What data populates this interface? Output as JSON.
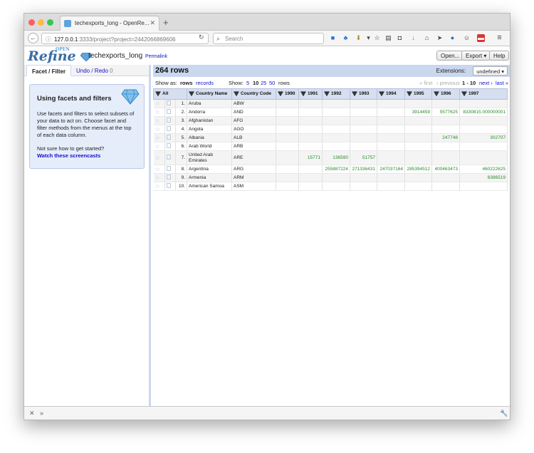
{
  "browser": {
    "tab_title": "techexports_long - OpenRe...",
    "tab_close": "✕",
    "new_tab": "+",
    "url_host": "127.0.0.1",
    "url_path": ":3333/project?project=2442066869606",
    "search_placeholder": "Search",
    "toolbar_icons": [
      "reading-list-icon",
      "share-icon",
      "download-icon",
      "bookmark-icon",
      "clipboard-icon",
      "pocket-icon",
      "downloads-icon",
      "home-icon",
      "send-icon",
      "drop-icon",
      "emoji-icon",
      "extension-icon",
      "menu-icon"
    ]
  },
  "header": {
    "logo": "Refine",
    "logo_open": "OPEN",
    "project_name": "techexports_long",
    "permalink": "Permalink",
    "buttons": {
      "open": "Open...",
      "export": "Export ▾",
      "help": "Help"
    }
  },
  "left": {
    "tabs": {
      "facet": "Facet / Filter",
      "undo": "Undo / Redo",
      "undo_count": "0"
    },
    "help": {
      "title": "Using facets and filters",
      "body": "Use facets and filters to select subsets of your data to act on. Choose facet and filter methods from the menus at the top of each data column.",
      "question": "Not sure how to get started?",
      "link": "Watch these screencasts"
    }
  },
  "main": {
    "row_count": "264 rows",
    "extensions_label": "Extensions:",
    "extensions_value": "undefined ▾",
    "show_as_label": "Show as:",
    "show_rows": "rows",
    "show_records": "records",
    "show_label": "Show:",
    "page_sizes": [
      "5",
      "10",
      "25",
      "50"
    ],
    "rows_word": "rows",
    "pager": {
      "first": "« first",
      "previous": "‹ previous",
      "range": "1 - 10",
      "next": "next ›",
      "last": "last »"
    }
  },
  "grid": {
    "columns": [
      "All",
      "Country Name",
      "Country Code",
      "1990",
      "1991",
      "1992",
      "1993",
      "1994",
      "1995",
      "1996",
      "1997"
    ],
    "rows": [
      {
        "idx": "1.",
        "name": "Aruba",
        "code": "ABW",
        "v": [
          "",
          "",
          "",
          "",
          "",
          "",
          "",
          ""
        ]
      },
      {
        "idx": "2.",
        "name": "Andorra",
        "code": "AND",
        "v": [
          "",
          "",
          "",
          "",
          "",
          "3914459",
          "5577625",
          "8330815.000000001"
        ]
      },
      {
        "idx": "3.",
        "name": "Afghanistan",
        "code": "AFG",
        "v": [
          "",
          "",
          "",
          "",
          "",
          "",
          "",
          ""
        ]
      },
      {
        "idx": "4.",
        "name": "Angola",
        "code": "AGO",
        "v": [
          "",
          "",
          "",
          "",
          "",
          "",
          "",
          ""
        ]
      },
      {
        "idx": "5.",
        "name": "Albania",
        "code": "ALB",
        "v": [
          "",
          "",
          "",
          "",
          "",
          "",
          "247748",
          "302707"
        ]
      },
      {
        "idx": "6.",
        "name": "Arab World",
        "code": "ARB",
        "v": [
          "",
          "",
          "",
          "",
          "",
          "",
          "",
          ""
        ]
      },
      {
        "idx": "7.",
        "name": "United Arab Emirates",
        "code": "ARE",
        "v": [
          "",
          "15771",
          "136590",
          "51757",
          "",
          "",
          "",
          ""
        ]
      },
      {
        "idx": "8.",
        "name": "Argentina",
        "code": "ARG",
        "v": [
          "",
          "",
          "255887224",
          "271336431",
          "247037164",
          "285394512",
          "400463473",
          "460222625"
        ]
      },
      {
        "idx": "9.",
        "name": "Armenia",
        "code": "ARM",
        "v": [
          "",
          "",
          "",
          "",
          "",
          "",
          "",
          "6386519"
        ]
      },
      {
        "idx": "10.",
        "name": "American Samoa",
        "code": "ASM",
        "v": [
          "",
          "",
          "",
          "",
          "",
          "",
          "",
          ""
        ]
      }
    ]
  }
}
